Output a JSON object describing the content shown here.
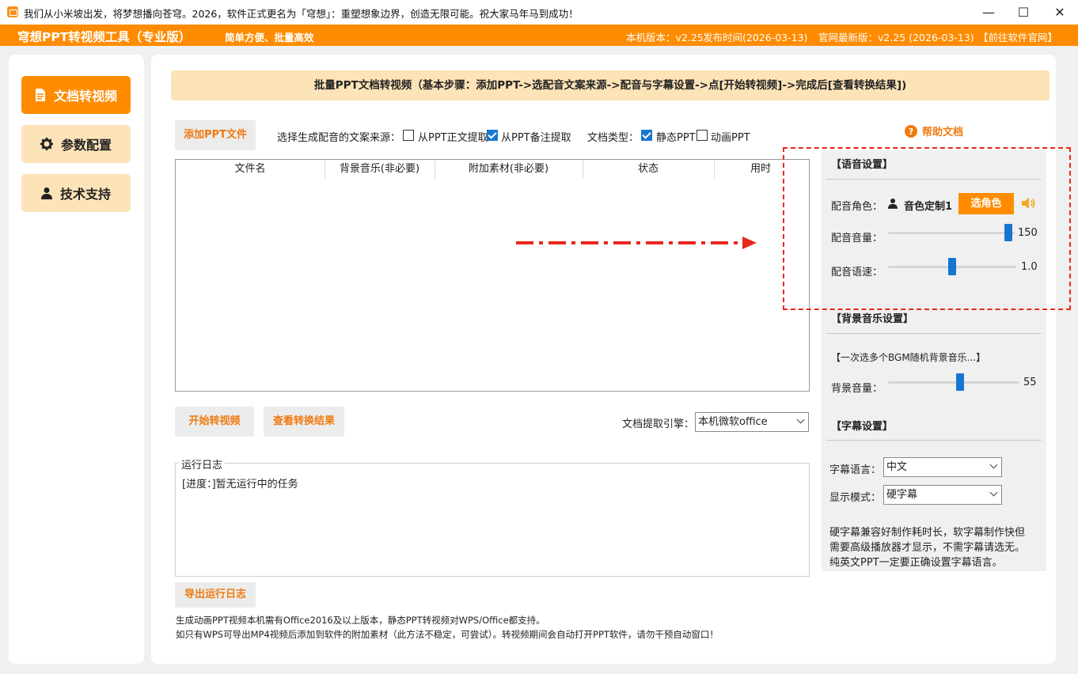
{
  "window": {
    "title": "我们从小米坡出发，将梦想播向苍穹。2026，软件正式更名为「穹想」：重塑想象边界，创造无限可能。祝大家马年马到成功！",
    "controls": {
      "minimize": "—",
      "maximize": "☐",
      "close": "✕"
    }
  },
  "header": {
    "app_name": "穹想PPT转视频工具（专业版）",
    "slogan": "简单方便、批量高效",
    "local_version": "本机版本：v2.25",
    "release_date": "发布时间(2026-03-13)",
    "latest_version": "官网最新版：v2.25 (2026-03-13)",
    "website_link": "【前往软件官网】"
  },
  "nav": {
    "items": [
      {
        "label": "文档转视频",
        "icon": "document-icon",
        "active": true
      },
      {
        "label": "参数配置",
        "icon": "gear-icon",
        "active": false
      },
      {
        "label": "技术支持",
        "icon": "user-icon",
        "active": false
      }
    ]
  },
  "main": {
    "banner": "批量PPT文档转视频（基本步骤：添加PPT->选配音文案来源->配音与字幕设置->点[开始转视频]->完成后[查看转换结果])",
    "add_ppt_button": "添加PPT文件",
    "source_label": "选择生成配音的文案来源：",
    "source_options": [
      {
        "label": "从PPT正文提取",
        "checked": false
      },
      {
        "label": "从PPT备注提取",
        "checked": true
      }
    ],
    "doc_type_label": "文档类型：",
    "doc_type_options": [
      {
        "label": "静态PPT",
        "checked": true
      },
      {
        "label": "动画PPT",
        "checked": false
      }
    ],
    "help_link": "帮助文档",
    "table_headers": [
      "文件名",
      "背景音乐(非必要)",
      "附加素材(非必要)",
      "状态",
      "用时"
    ],
    "start_button": "开始转视频",
    "view_result_button": "查看转换结果",
    "engine_label": "文档提取引擎：",
    "engine_value": "本机微软office",
    "log_title": "运行日志",
    "log_text": "[进度：]暂无运行中的任务",
    "export_log_button": "导出运行日志",
    "notes": [
      "生成动画PPT视频本机需有Office2016及以上版本，静态PPT转视频对WPS/Office都支持。",
      "如只有WPS可导出MP4视频后添加到软件的附加素材（此方法不稳定，可尝试）。转视频期间会自动打开PPT软件，请勿干预自动窗口！"
    ]
  },
  "settings": {
    "voice_section": "【语音设置】",
    "voice_role_label": "配音角色：",
    "voice_role_value": "音色定制1",
    "choose_voice_button": "选角色",
    "volume_label": "配音音量：",
    "volume_value": "150",
    "volume_fraction": 0.98,
    "speed_label": "配音语速：",
    "speed_value": "1.0",
    "speed_fraction": 0.5,
    "bgm_section": "【背景音乐设置】",
    "bgm_hint": "【一次选多个BGM随机背景音乐...】",
    "bgm_volume_label": "背景音量：",
    "bgm_volume_value": "55",
    "bgm_volume_fraction": 0.55,
    "subtitle_section": "【字幕设置】",
    "subtitle_lang_label": "字幕语言：",
    "subtitle_lang_value": "中文",
    "display_mode_label": "显示模式：",
    "display_mode_value": "硬字幕",
    "subtitle_notes": [
      "硬字幕兼容好制作耗时长，软字幕制作快但",
      "需要高级播放器才显示，不需字幕请选无。",
      "纯英文PPT一定要正确设置字幕语言。"
    ]
  },
  "colors": {
    "accent": "#ff8c00",
    "accent_light": "#fde3b8",
    "slider": "#1676d2",
    "annotation": "#e8281c"
  }
}
